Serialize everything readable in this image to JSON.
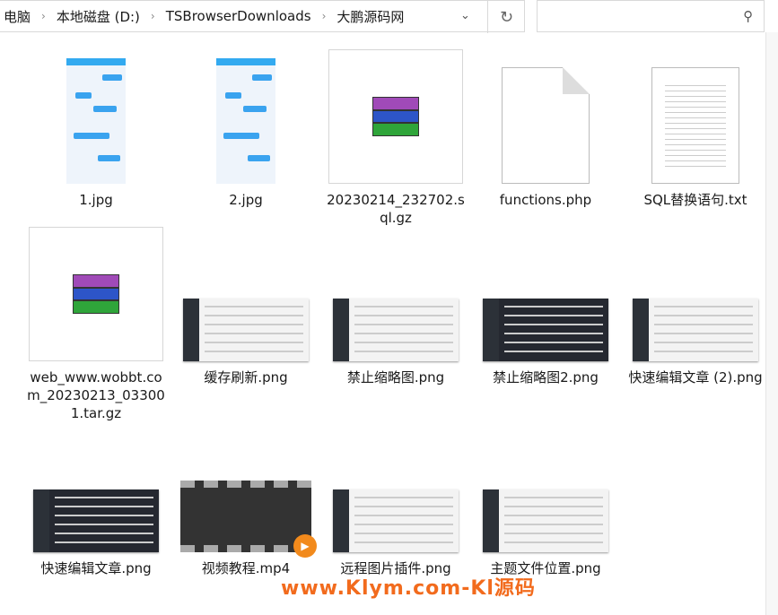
{
  "breadcrumb": [
    "电脑",
    "本地磁盘 (D:)",
    "TSBrowserDownloads",
    "大鹏源码网"
  ],
  "icons": {
    "dropdown": "chevron-down-icon",
    "refresh": "refresh-icon",
    "search": "search-icon"
  },
  "files": [
    {
      "name": "1.jpg",
      "type": "phone"
    },
    {
      "name": "2.jpg",
      "type": "phone"
    },
    {
      "name": "20230214_232702.sql.gz",
      "type": "archive"
    },
    {
      "name": "functions.php",
      "type": "blank"
    },
    {
      "name": "SQL替换语句.txt",
      "type": "text"
    },
    {
      "name": "web_www.wobbt.com_20230213_033001.tar.gz",
      "type": "archive"
    },
    {
      "name": "缓存刷新.png",
      "type": "shot"
    },
    {
      "name": "禁止缩略图.png",
      "type": "shot"
    },
    {
      "name": "禁止缩略图2.png",
      "type": "darkshot"
    },
    {
      "name": "快速编辑文章 (2).png",
      "type": "shot"
    },
    {
      "name": "快速编辑文章.png",
      "type": "darkshot"
    },
    {
      "name": "视频教程.mp4",
      "type": "video"
    },
    {
      "name": "远程图片插件.png",
      "type": "shot"
    },
    {
      "name": "主题文件位置.png",
      "type": "shot"
    }
  ],
  "watermark": "www.Klym.com-Kl源码"
}
